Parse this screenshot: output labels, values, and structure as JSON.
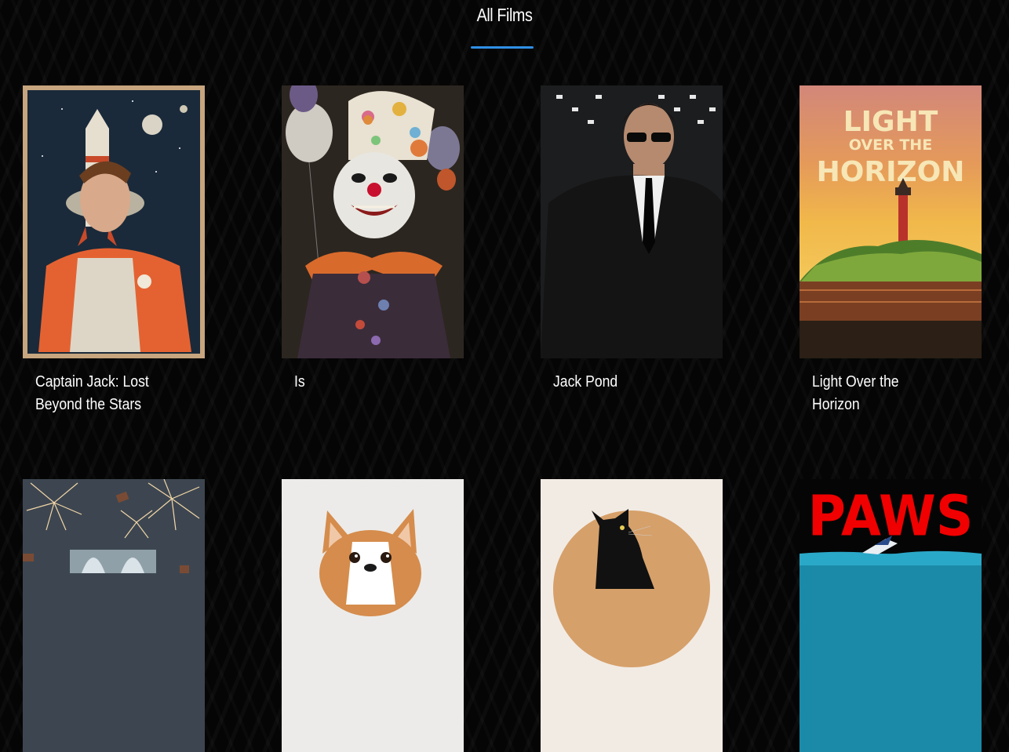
{
  "page": {
    "title": "All Films"
  },
  "films": [
    {
      "title": "Captain Jack: Lost Beyond the Stars",
      "poster_icon": "astronaut-poster"
    },
    {
      "title": "Is",
      "poster_icon": "clown-poster"
    },
    {
      "title": "Jack Pond",
      "poster_icon": "agent-in-suit-poster"
    },
    {
      "title": "Light Over the Horizon",
      "poster_icon": "lighthouse-poster",
      "poster_text": [
        "LIGHT",
        "OVER THE",
        "HORIZON"
      ]
    },
    {
      "title": "",
      "poster_icon": "fireworks-poster"
    },
    {
      "title": "",
      "poster_icon": "corgi-poster"
    },
    {
      "title": "",
      "poster_icon": "black-cat-poster"
    },
    {
      "title": "",
      "poster_icon": "paws-poster",
      "poster_text": [
        "PAWS"
      ]
    }
  ],
  "colors": {
    "accent": "#2f8fe6",
    "background": "#050505",
    "text": "#ffffff"
  }
}
